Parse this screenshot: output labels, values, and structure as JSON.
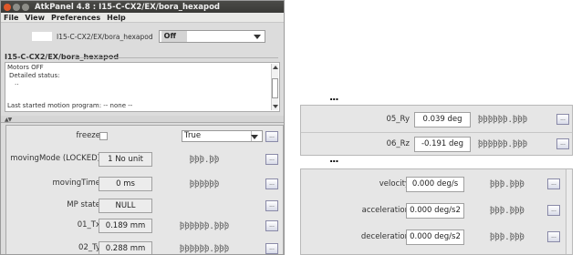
{
  "window": {
    "title": "AtkPanel 4.8 : I15-C-CX2/EX/bora_hexapod",
    "menu": [
      "File",
      "View",
      "Preferences",
      "Help"
    ]
  },
  "device": {
    "name": "I15-C-CX2/EX/bora_hexapod",
    "state": "Off",
    "state_color": "#d4d4d4"
  },
  "status": {
    "title": "I15-C-CX2/EX/bora_hexapod",
    "lines": [
      "Motors OFF",
      "Detailed status:",
      "..",
      "",
      "Last started motion program: -- none --"
    ]
  },
  "attributes": [
    {
      "label": "freeze",
      "kind": "bool",
      "checked": false,
      "combo": "True"
    },
    {
      "label": "movingMode (LOCKED)",
      "value": "1 No unit",
      "spin": "000.00"
    },
    {
      "label": "movingTime",
      "value": "0 ms",
      "spin": "000000"
    },
    {
      "label": "MP state",
      "value": "NULL"
    },
    {
      "label": "01_Tx",
      "value": "0.189 mm",
      "spin": "000000.000"
    },
    {
      "label": "02_Ty",
      "value": "0.288 mm",
      "spin": "000000.000"
    }
  ],
  "edit_button_label": "...",
  "zoom_top": {
    "ellipsis": "...",
    "rows": [
      {
        "label": "05_Ry",
        "value": "0.039 deg",
        "spin": "000000.000"
      },
      {
        "label": "06_Rz",
        "value": "-0.191 deg",
        "spin": "000000.000"
      }
    ]
  },
  "zoom_bottom": {
    "ellipsis": "...",
    "rows": [
      {
        "label": "velocity",
        "value": "0.000 deg/s",
        "spin": "000.000"
      },
      {
        "label": "acceleration",
        "value": "0.000 deg/s2",
        "spin": "000.000"
      },
      {
        "label": "deceleration",
        "value": "0.000 deg/s2",
        "spin": "000.000"
      }
    ]
  }
}
